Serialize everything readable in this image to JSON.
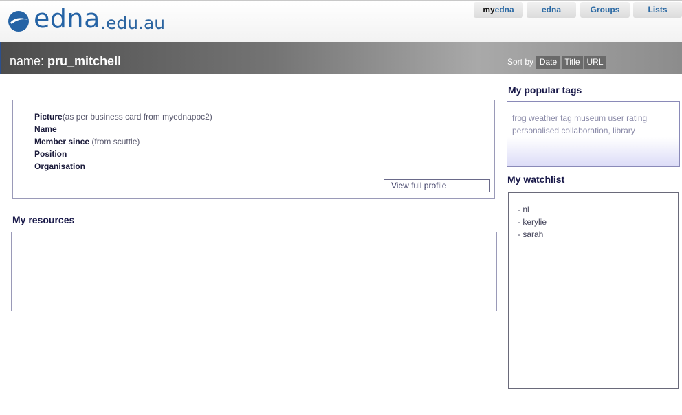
{
  "logo": {
    "word": "edna",
    "suffix": ".edu.au"
  },
  "nav": {
    "tabs": [
      {
        "prefix": "my",
        "label": "edna"
      },
      {
        "label": "edna"
      },
      {
        "label": "Groups"
      },
      {
        "label": "Lists"
      }
    ]
  },
  "banner": {
    "name_label": "name:",
    "username": "pru_mitchell",
    "sort_label": "Sort by",
    "sort_options": [
      "Date",
      "Title",
      "URL"
    ]
  },
  "profile": {
    "picture_label": "Picture",
    "picture_note": "(as per business card from myednapoc2)",
    "name_label": "Name",
    "member_since_label": "Member since",
    "member_since_note": " (from scuttle)",
    "position_label": "Position",
    "organisation_label": "Organisation",
    "view_full_profile": "View full profile"
  },
  "resources": {
    "heading": "My resources"
  },
  "tags": {
    "heading": "My popular tags",
    "items": [
      "frog",
      "weather",
      "tag",
      "museum",
      "user",
      "rating",
      "personalised",
      "collaboration,",
      "library"
    ]
  },
  "watchlist": {
    "heading": "My watchlist",
    "items": [
      "- nl",
      "- kerylie",
      "- sarah"
    ]
  },
  "colors": {
    "brand": "#2563a5",
    "heading": "#1a1a4a",
    "border": "#9a9ab8"
  }
}
